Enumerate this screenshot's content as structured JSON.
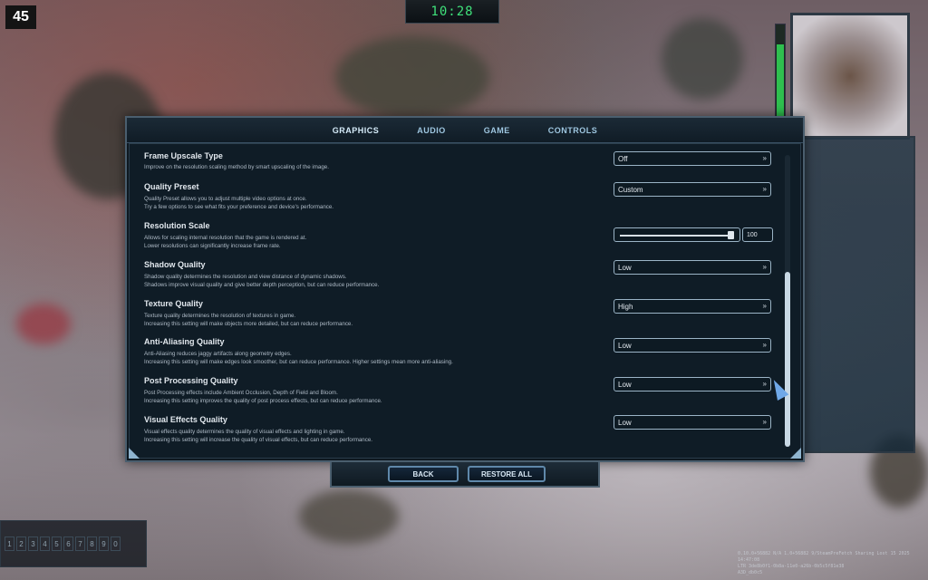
{
  "hud": {
    "fps": "45",
    "clock": "10:28",
    "hotbar_slots": [
      "1",
      "2",
      "3",
      "4",
      "5",
      "6",
      "7",
      "8",
      "9",
      "0"
    ],
    "build_info": [
      "0.10.0+56882 N/A 1.0+56882 9/SteamPreFetch Sharing Lost 15 2025 14:47:08",
      "LTR 3de8b0f1-0b8a-11e0-a26b-0b5c5f81e38",
      "A3D_db0c5"
    ]
  },
  "tabs": [
    {
      "label": "GRAPHICS",
      "active": true
    },
    {
      "label": "AUDIO",
      "active": false
    },
    {
      "label": "GAME",
      "active": false
    },
    {
      "label": "CONTROLS",
      "active": false
    }
  ],
  "settings": [
    {
      "title": "Frame Upscale Type",
      "desc": [
        "Improve on the resolution scaling method by smart upscaling of the image."
      ],
      "value": "Off"
    },
    {
      "title": "Quality Preset",
      "desc": [
        "Quality Preset allows you to adjust multiple video options at once.",
        "Try a few options to see what fits your preference and device's performance."
      ],
      "value": "Custom"
    },
    {
      "title": "Resolution Scale",
      "desc": [
        "Allows for scaling internal resolution that the game is rendered at.",
        "Lower resolutions can significantly increase frame rate."
      ],
      "value": "100",
      "slider_fraction": 1.0
    },
    {
      "title": "Shadow Quality",
      "desc": [
        "Shadow quality determines the resolution and view distance of dynamic shadows.",
        "Shadows improve visual quality and give better depth perception, but can reduce performance."
      ],
      "value": "Low"
    },
    {
      "title": "Texture Quality",
      "desc": [
        "Texture quality determines the resolution of textures in game.",
        "Increasing this setting will make objects more detailed, but can reduce performance."
      ],
      "value": "High"
    },
    {
      "title": "Anti-Aliasing Quality",
      "desc": [
        "Anti-Aliasing reduces jaggy artifacts along geometry edges.",
        "Increasing this setting will make edges look smoother, but can reduce performance. Higher settings mean more anti-aliasing."
      ],
      "value": "Low"
    },
    {
      "title": "Post Processing Quality",
      "desc": [
        "Post Processing effects include Ambient Occlusion, Depth of Field and Bloom.",
        "Increasing this setting improves the quality of post process effects, but can reduce performance."
      ],
      "value": "Low"
    },
    {
      "title": "Visual Effects Quality",
      "desc": [
        "Visual effects quality determines the quality of visual effects and lighting in game.",
        "Increasing this setting will increase the quality of visual effects, but can reduce performance."
      ],
      "value": "Low"
    }
  ],
  "scrollbar": {
    "position_fraction": 1.0,
    "visible_fraction": 0.6
  },
  "footer": {
    "back": "BACK",
    "restore_all": "RESTORE ALL"
  },
  "colors": {
    "accent": "#9ec6e0",
    "panel": "#0f1c26",
    "border": "#4a5e6e"
  }
}
